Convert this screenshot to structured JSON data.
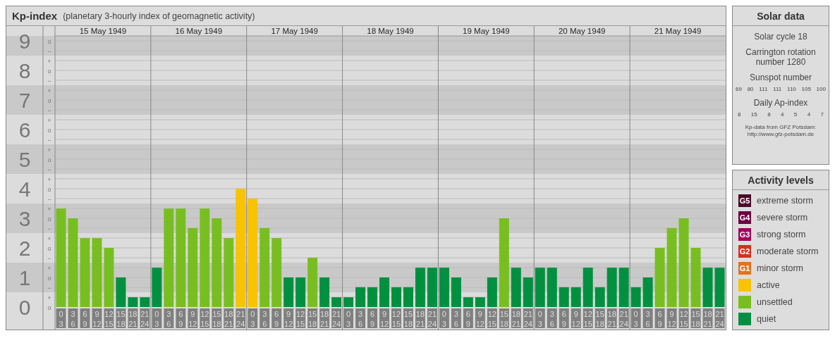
{
  "header": {
    "title": "Kp-index",
    "subtitle": "(planetary 3-hourly index of geomagnetic activity)"
  },
  "kp_chart": {
    "days": [
      "15 May 1949",
      "16 May 1949",
      "17 May 1949",
      "18 May 1949",
      "19 May 1949",
      "20 May 1949",
      "21 May 1949"
    ],
    "minor_ticks": [
      "o",
      "−",
      "+",
      "o",
      "−",
      "+",
      "o",
      "−",
      "+",
      "o",
      "−",
      "+",
      "o",
      "−",
      "+",
      "o",
      "−",
      "+",
      "o",
      "−",
      "+",
      "o",
      "−",
      "+",
      "o",
      "−",
      "+",
      "o"
    ],
    "chart_data": {
      "type": "bar",
      "stacked": true,
      "grid": true,
      "ylim": [
        0,
        9.17
      ],
      "yticks": [
        {
          "value": 0,
          "label": "0"
        },
        {
          "value": 1,
          "label": "1"
        },
        {
          "value": 2,
          "label": "2"
        },
        {
          "value": 3,
          "label": "3"
        },
        {
          "value": 4,
          "label": "4"
        },
        {
          "value": 5,
          "label": "5"
        },
        {
          "value": 6,
          "label": "6"
        },
        {
          "value": 7,
          "label": "7"
        },
        {
          "value": 8,
          "label": "8"
        },
        {
          "value": 9,
          "label": "9"
        }
      ],
      "categories": [
        "0 3",
        "3 6",
        "6 9",
        "9 12",
        "12 15",
        "15 18",
        "18 21",
        "21 24",
        "0 3",
        "3 6",
        "6 9",
        "9 12",
        "12 15",
        "15 18",
        "18 21",
        "21 24",
        "0 3",
        "3 6",
        "6 9",
        "9 12",
        "12 15",
        "15 18",
        "18 21",
        "21 24",
        "0 3",
        "3 6",
        "6 9",
        "9 12",
        "12 15",
        "15 18",
        "18 21",
        "21 24",
        "0 3",
        "3 6",
        "6 9",
        "9 12",
        "12 15",
        "15 18",
        "18 21",
        "21 24",
        "0 3",
        "3 6",
        "6 9",
        "9 12",
        "12 15",
        "15 18",
        "18 21",
        "21 24",
        "0 3",
        "3 6",
        "6 9",
        "9 12",
        "12 15",
        "15 18",
        "18 21",
        "21 24"
      ],
      "series": [
        {
          "name": "quiet",
          "color": "#00903f",
          "values": [
            null,
            null,
            null,
            null,
            null,
            1,
            0.33,
            0.33,
            1.33,
            null,
            null,
            null,
            null,
            null,
            null,
            null,
            null,
            null,
            null,
            1,
            1,
            null,
            1,
            0.33,
            0.33,
            0.67,
            0.67,
            1,
            0.67,
            0.67,
            1.33,
            1.33,
            1.33,
            1,
            0.33,
            0.33,
            1,
            null,
            1.33,
            1,
            1.33,
            1.33,
            0.67,
            0.67,
            1.33,
            0.67,
            1.33,
            1.33,
            0.67,
            1,
            null,
            null,
            null,
            null,
            1.33,
            1.33
          ]
        },
        {
          "name": "unsettled",
          "color": "#78be21",
          "values": [
            3.33,
            3,
            2.33,
            2.33,
            2,
            null,
            null,
            null,
            null,
            3.33,
            3.33,
            2.67,
            3.33,
            3,
            2.33,
            null,
            null,
            2.67,
            2.33,
            null,
            null,
            1.67,
            null,
            null,
            null,
            null,
            null,
            null,
            null,
            null,
            null,
            null,
            null,
            null,
            null,
            null,
            null,
            3,
            null,
            null,
            null,
            null,
            null,
            null,
            null,
            null,
            null,
            null,
            null,
            null,
            2,
            2.67,
            3,
            2,
            null,
            null
          ]
        },
        {
          "name": "active",
          "color": "#f8c300",
          "values": [
            null,
            null,
            null,
            null,
            null,
            null,
            null,
            null,
            null,
            null,
            null,
            null,
            null,
            null,
            null,
            4,
            3.67,
            null,
            null,
            null,
            null,
            null,
            null,
            null,
            null,
            null,
            null,
            null,
            null,
            null,
            null,
            null,
            null,
            null,
            null,
            null,
            null,
            null,
            null,
            null,
            null,
            null,
            null,
            null,
            null,
            null,
            null,
            null,
            null,
            null,
            null,
            null,
            null,
            null,
            null,
            null
          ]
        }
      ]
    }
  },
  "solar_data": {
    "title": "Solar data",
    "solar_cycle": "Solar cycle 18",
    "carrington": "Carrington rotation number 1280",
    "sunspot_title": "Sunspot number",
    "sunspot_numbers": [
      "69",
      "80",
      "111",
      "111",
      "110",
      "105",
      "100"
    ],
    "ap_title": "Daily Ap-index",
    "ap_values": [
      "8",
      "15",
      "8",
      "4",
      "5",
      "4",
      "7"
    ],
    "credit_lines": [
      "Kp-data from GFZ Potsdam:",
      "http://www.gfz-potsdam.de"
    ]
  },
  "activity_levels": {
    "title": "Activity levels",
    "items": [
      {
        "badge": "G5",
        "label": "extreme storm",
        "color": "#4b0a2a"
      },
      {
        "badge": "G4",
        "label": "severe storm",
        "color": "#6a0040"
      },
      {
        "badge": "G3",
        "label": "strong storm",
        "color": "#a3005c"
      },
      {
        "badge": "G2",
        "label": "moderate storm",
        "color": "#d4301a"
      },
      {
        "badge": "G1",
        "label": "minor storm",
        "color": "#e4721a"
      }
    ]
  }
}
